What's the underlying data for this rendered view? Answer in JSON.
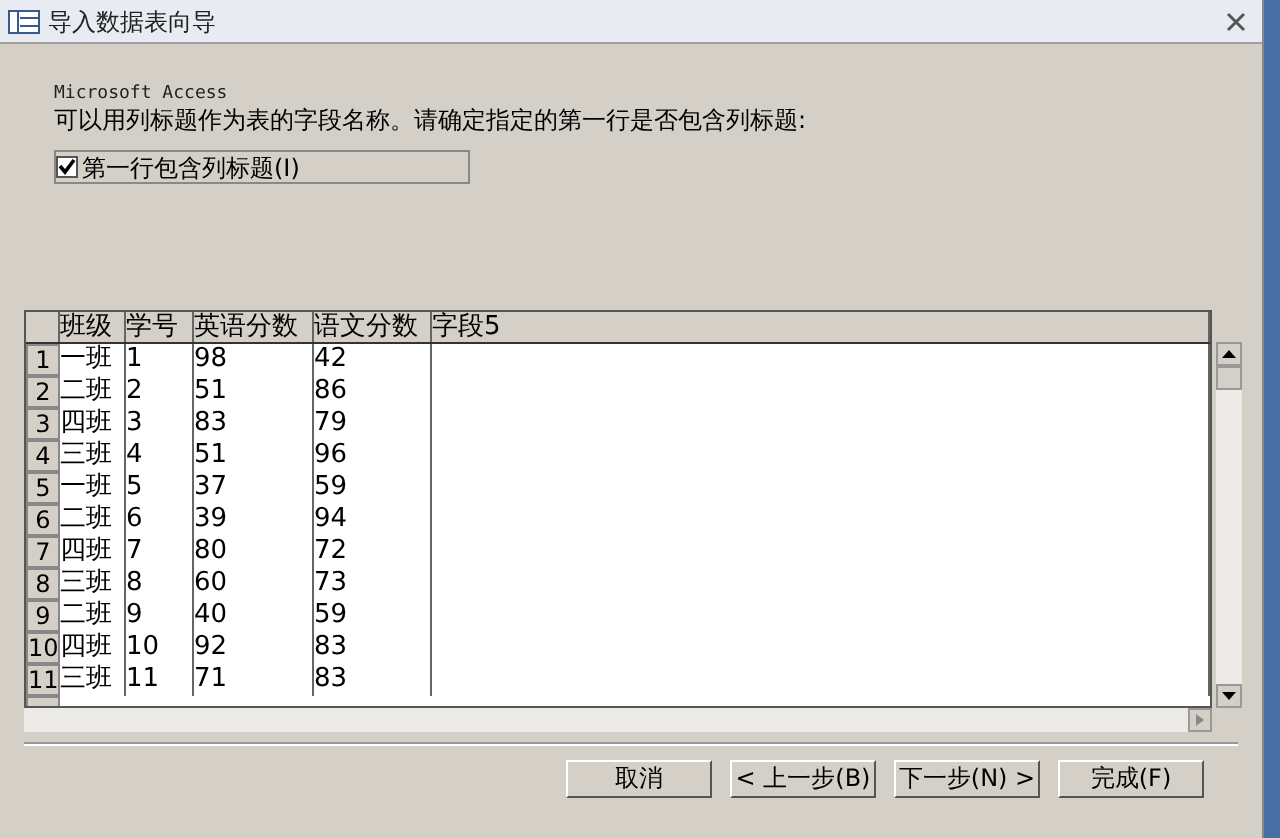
{
  "window": {
    "title": "导入数据表向导"
  },
  "app_name": "Microsoft Access",
  "instruction": "可以用列标题作为表的字段名称。请确定指定的第一行是否包含列标题:",
  "first_row_headers": {
    "label": "第一行包含列标题(I)",
    "checked": true
  },
  "table": {
    "columns": [
      "班级",
      "学号",
      "英语分数",
      "语文分数",
      "字段5"
    ],
    "rows": [
      {
        "number": "1",
        "cells": [
          "一班",
          "1",
          "98",
          "42",
          ""
        ]
      },
      {
        "number": "2",
        "cells": [
          "二班",
          "2",
          "51",
          "86",
          ""
        ]
      },
      {
        "number": "3",
        "cells": [
          "四班",
          "3",
          "83",
          "79",
          ""
        ]
      },
      {
        "number": "4",
        "cells": [
          "三班",
          "4",
          "51",
          "96",
          ""
        ]
      },
      {
        "number": "5",
        "cells": [
          "一班",
          "5",
          "37",
          "59",
          ""
        ]
      },
      {
        "number": "6",
        "cells": [
          "二班",
          "6",
          "39",
          "94",
          ""
        ]
      },
      {
        "number": "7",
        "cells": [
          "四班",
          "7",
          "80",
          "72",
          ""
        ]
      },
      {
        "number": "8",
        "cells": [
          "三班",
          "8",
          "60",
          "73",
          ""
        ]
      },
      {
        "number": "9",
        "cells": [
          "二班",
          "9",
          "40",
          "59",
          ""
        ]
      },
      {
        "number": "10",
        "cells": [
          "四班",
          "10",
          "92",
          "83",
          ""
        ]
      },
      {
        "number": "11",
        "cells": [
          "三班",
          "11",
          "71",
          "83",
          ""
        ]
      }
    ]
  },
  "buttons": [
    {
      "label": "取消"
    },
    {
      "label": "< 上一步(B)"
    },
    {
      "label": "下一步(N) >"
    },
    {
      "label": "完成(F)"
    }
  ]
}
